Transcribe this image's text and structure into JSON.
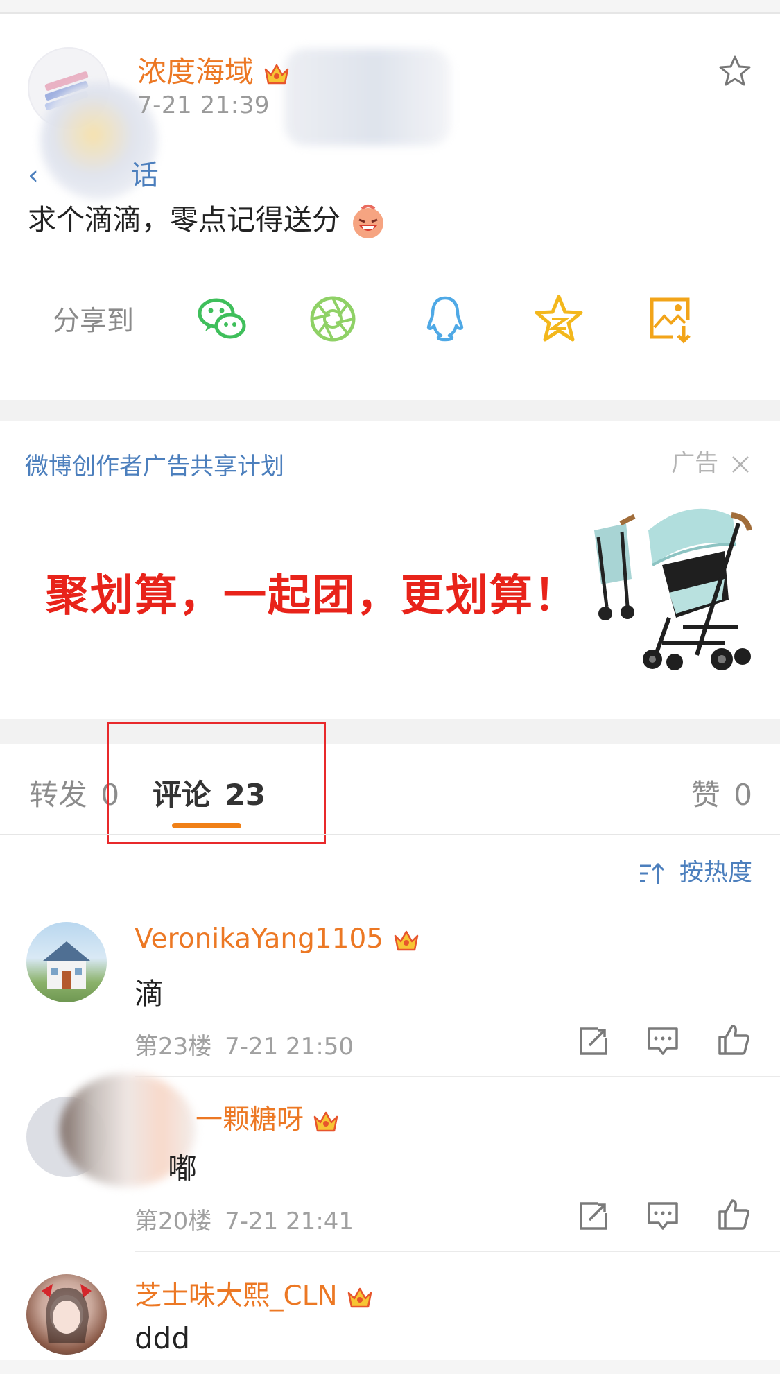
{
  "colors": {
    "brand_orange": "#ec7824",
    "link_blue": "#4c7fbd",
    "tab_indicator": "#f08017",
    "highlight_box": "#e8292b",
    "ad_red": "#e8231a"
  },
  "post": {
    "author": "浓度海域",
    "time": "7-21 21:39",
    "topic": "话",
    "text": "求个滴滴，零点记得送分",
    "text_emoji": "laughing-face-emoji",
    "favorite_icon": "star-outline-icon"
  },
  "share": {
    "label": "分享到",
    "targets": [
      {
        "name": "wechat",
        "icon": "wechat-icon"
      },
      {
        "name": "moments",
        "icon": "moments-icon"
      },
      {
        "name": "qq",
        "icon": "qq-icon"
      },
      {
        "name": "qzone",
        "icon": "qzone-icon"
      },
      {
        "name": "save-image",
        "icon": "save-image-icon"
      }
    ]
  },
  "ad": {
    "program": "微博创作者广告共享计划",
    "tag": "广告",
    "close_icon": "close-icon",
    "headline": "聚划算，一起团，更划算！",
    "image": "stroller-image"
  },
  "tabs": {
    "repost_label": "转发",
    "repost_count": "0",
    "comments_label": "评论",
    "comments_count": "23",
    "likes_label": "赞",
    "likes_count": "0"
  },
  "sort": {
    "label": "按热度",
    "icon": "sort-icon"
  },
  "comments": [
    {
      "user": "VeronikaYang1105",
      "text": "滴",
      "floor": "第23楼",
      "time": "7-21 21:50"
    },
    {
      "user": "一颗糖呀",
      "text": "嘟",
      "floor": "第20楼",
      "time": "7-21 21:41"
    },
    {
      "user": "芝士味大熙_CLN",
      "text": "ddd"
    }
  ]
}
